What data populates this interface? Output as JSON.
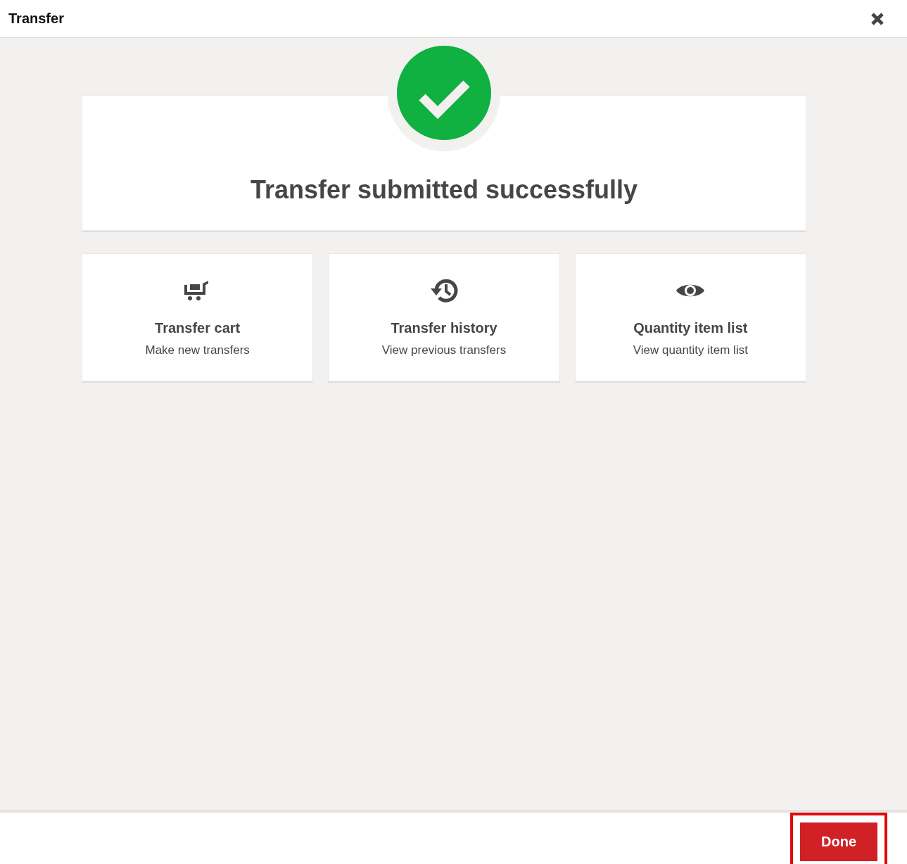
{
  "window": {
    "title": "Transfer"
  },
  "success": {
    "message": "Transfer submitted successfully"
  },
  "tiles": [
    {
      "kind": "cart",
      "title": "Transfer cart",
      "subtitle": "Make new transfers"
    },
    {
      "kind": "history",
      "title": "Transfer history",
      "subtitle": "View previous transfers"
    },
    {
      "kind": "eye",
      "title": "Quantity item list",
      "subtitle": "View quantity item list"
    }
  ],
  "footer": {
    "button": {
      "label": "Done",
      "highlighted": true
    }
  }
}
